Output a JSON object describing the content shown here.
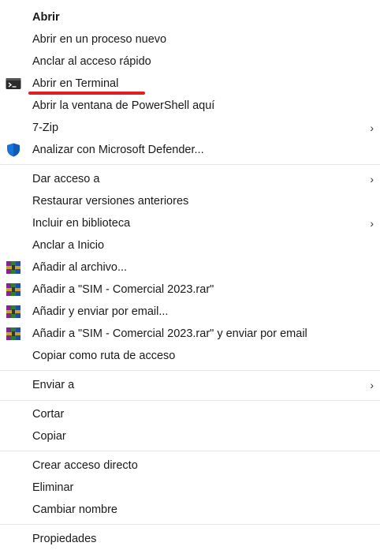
{
  "menu": {
    "items": [
      {
        "label": "Abrir"
      },
      {
        "label": "Abrir en un proceso nuevo"
      },
      {
        "label": "Anclar al acceso rápido"
      },
      {
        "label": "Abrir en Terminal",
        "icon": "terminal-icon"
      },
      {
        "label": "Abrir la ventana de PowerShell aquí"
      },
      {
        "label": "7-Zip",
        "submenu": "›"
      },
      {
        "label": "Analizar con Microsoft Defender...",
        "icon": "defender-shield-icon"
      },
      {
        "label": "Dar acceso a",
        "submenu": "›"
      },
      {
        "label": "Restaurar versiones anteriores"
      },
      {
        "label": "Incluir en biblioteca",
        "submenu": "›"
      },
      {
        "label": "Anclar a Inicio"
      },
      {
        "label": "Añadir al archivo...",
        "icon": "winrar-icon"
      },
      {
        "label": "Añadir a \"SIM - Comercial 2023.rar\"",
        "icon": "winrar-icon"
      },
      {
        "label": "Añadir y enviar por email...",
        "icon": "winrar-icon"
      },
      {
        "label": "Añadir a \"SIM - Comercial 2023.rar\" y enviar por email",
        "icon": "winrar-icon"
      },
      {
        "label": "Copiar como ruta de acceso"
      },
      {
        "label": "Enviar a",
        "submenu": "›"
      },
      {
        "label": "Cortar"
      },
      {
        "label": "Copiar"
      },
      {
        "label": "Crear acceso directo"
      },
      {
        "label": "Eliminar"
      },
      {
        "label": "Cambiar nombre"
      },
      {
        "label": "Propiedades"
      }
    ]
  },
  "colors": {
    "highlight_underline": "#e02020",
    "separator": "#e5e5e5",
    "defender_blue": "#1a73d9"
  }
}
